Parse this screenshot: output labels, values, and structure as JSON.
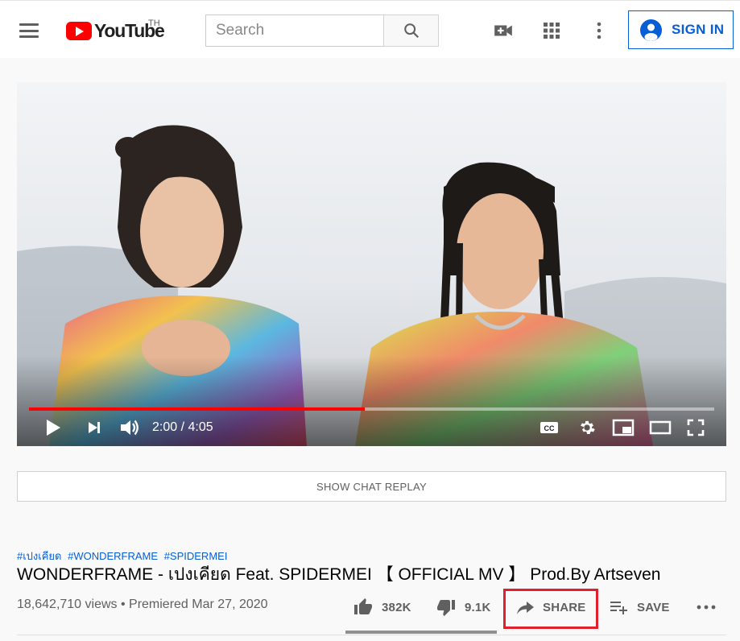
{
  "header": {
    "logo_text": "YouTube",
    "region": "TH",
    "search_placeholder": "Search",
    "signin_label": "SIGN IN"
  },
  "player": {
    "current_time": "2:00",
    "duration": "4:05",
    "time_display": "2:00 / 4:05",
    "progress_fraction": 0.49
  },
  "chat": {
    "label": "SHOW CHAT REPLAY"
  },
  "video_info": {
    "hashtags": [
      "#เปงเคียด",
      "#WONDERFRAME",
      "#SPIDERMEI"
    ],
    "title": "WONDERFRAME - เปงเคียด Feat. SPIDERMEI 【 OFFICIAL MV 】 Prod.By Artseven",
    "meta": "18,642,710 views • Premiered Mar 27, 2020",
    "likes": "382K",
    "dislikes": "9.1K",
    "share_label": "SHARE",
    "save_label": "SAVE"
  },
  "colors": {
    "brand_red": "#ff0000",
    "link_blue": "#065fd4",
    "highlight_box": "#e2202d"
  }
}
